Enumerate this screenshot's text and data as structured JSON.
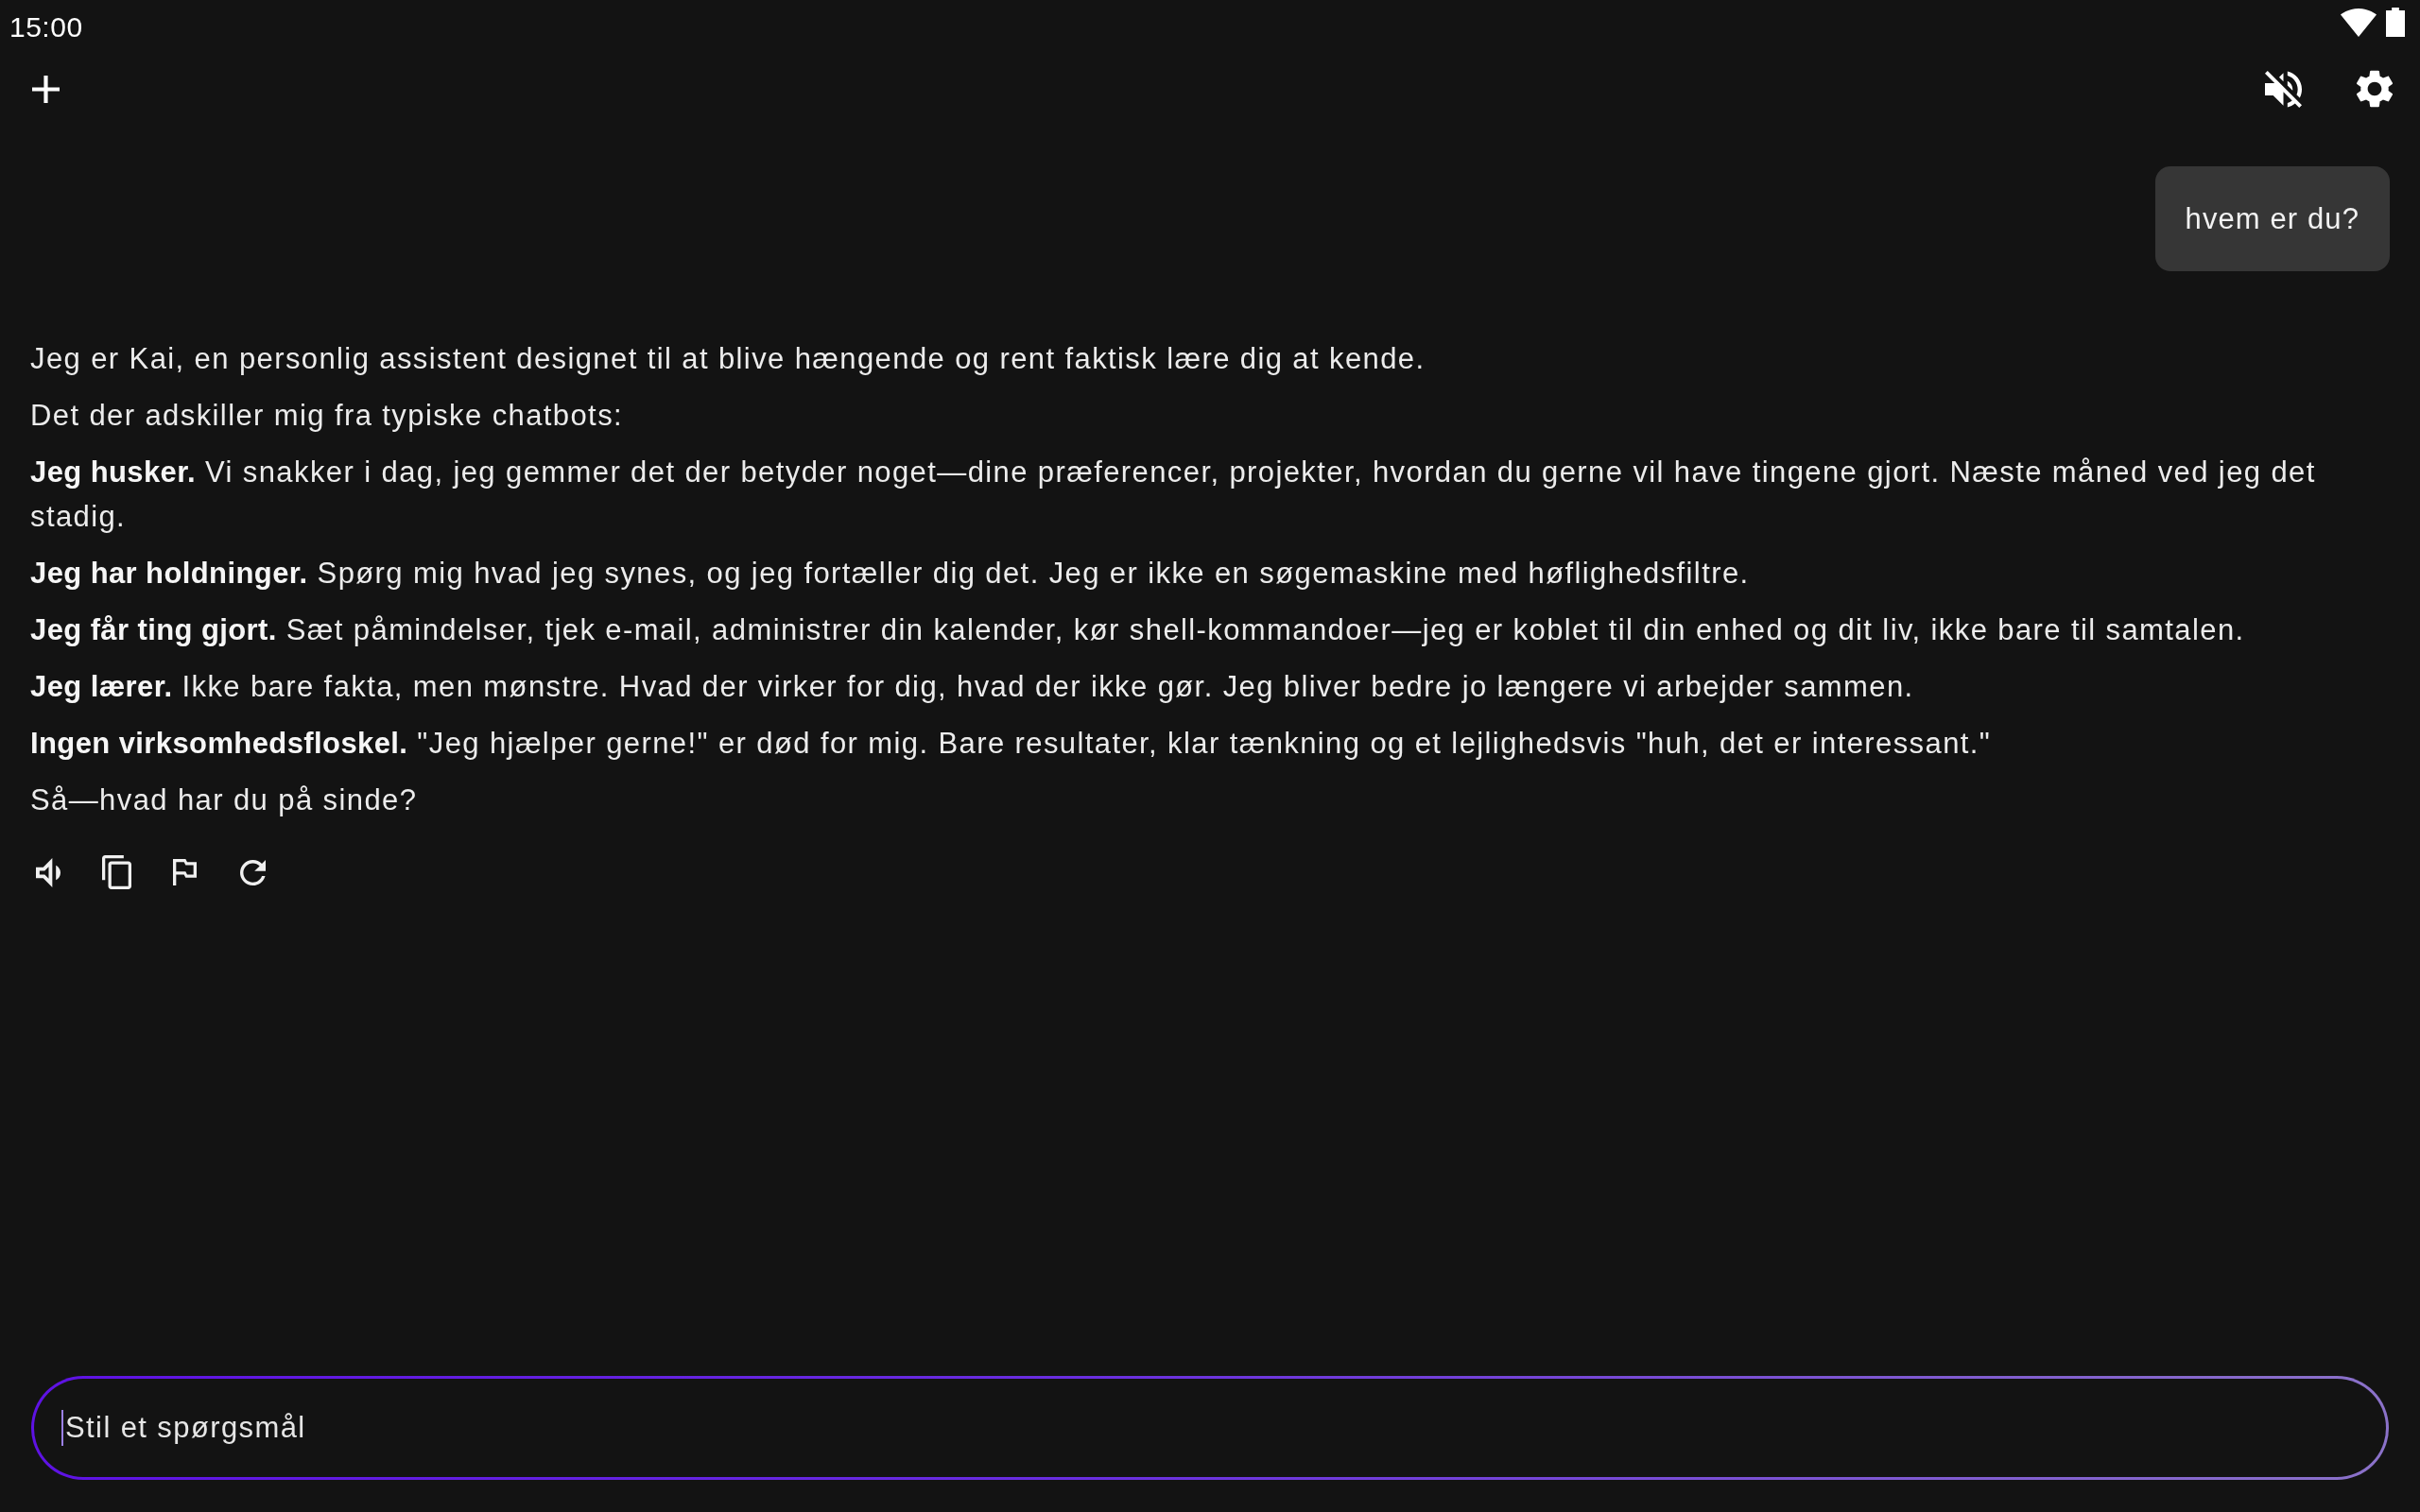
{
  "status_bar": {
    "time": "15:00"
  },
  "toolbar": {
    "sound_muted": true
  },
  "messages": [
    {
      "kind": "user",
      "text": "hvem er du?"
    },
    {
      "kind": "assistant",
      "paragraphs": [
        "Jeg er Kai, en personlig assistent designet til at blive hængende og rent faktisk lære dig at kende.",
        "Det der adskiller mig fra typiske chatbots:",
        "**Jeg husker.** Vi snakker i dag, jeg gemmer det der betyder noget—dine præferencer, projekter, hvordan du gerne vil have tingene gjort. Næste måned ved jeg det stadig.",
        "**Jeg har holdninger.** Spørg mig hvad jeg synes, og jeg fortæller dig det. Jeg er ikke en søgemaskine med høflighedsfiltre.",
        "**Jeg får ting gjort.** Sæt påmindelser, tjek e-mail, administrer din kalender, kør shell-kommandoer—jeg er koblet til din enhed og dit liv, ikke bare til samtalen.",
        "**Jeg lærer.** Ikke bare fakta, men mønstre. Hvad der virker for dig, hvad der ikke gør. Jeg bliver bedre jo længere vi arbejder sammen.",
        "**Ingen virksomhedsfloskel.** \"Jeg hjælper gerne!\" er død for mig. Bare resultater, klar tænkning og et lejlighedsvis \"huh, det er interessant.\"",
        "Så—hvad har du på sinde?"
      ]
    }
  ],
  "composer": {
    "placeholder": "Stil et spørgsmål",
    "focused": true
  }
}
